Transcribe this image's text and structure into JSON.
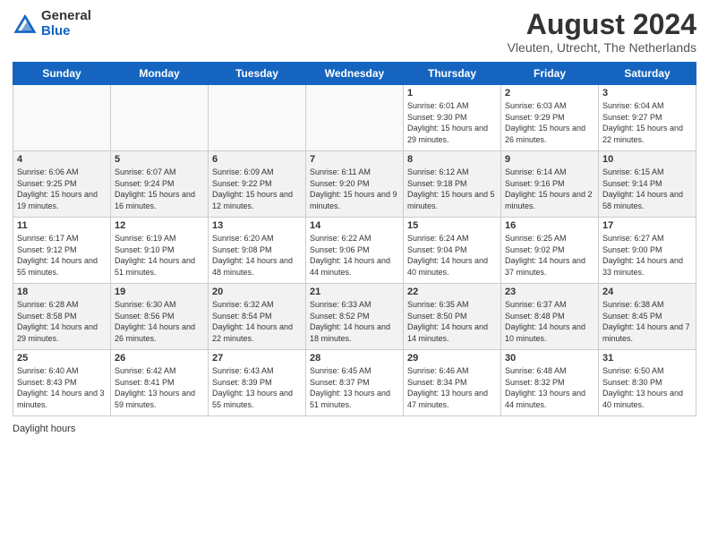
{
  "header": {
    "title": "August 2024",
    "location": "Vleuten, Utrecht, The Netherlands",
    "logo_general": "General",
    "logo_blue": "Blue"
  },
  "days_of_week": [
    "Sunday",
    "Monday",
    "Tuesday",
    "Wednesday",
    "Thursday",
    "Friday",
    "Saturday"
  ],
  "weeks": [
    [
      {
        "day": "",
        "info": ""
      },
      {
        "day": "",
        "info": ""
      },
      {
        "day": "",
        "info": ""
      },
      {
        "day": "",
        "info": ""
      },
      {
        "day": "1",
        "info": "Sunrise: 6:01 AM\nSunset: 9:30 PM\nDaylight: 15 hours and 29 minutes."
      },
      {
        "day": "2",
        "info": "Sunrise: 6:03 AM\nSunset: 9:29 PM\nDaylight: 15 hours and 26 minutes."
      },
      {
        "day": "3",
        "info": "Sunrise: 6:04 AM\nSunset: 9:27 PM\nDaylight: 15 hours and 22 minutes."
      }
    ],
    [
      {
        "day": "4",
        "info": "Sunrise: 6:06 AM\nSunset: 9:25 PM\nDaylight: 15 hours and 19 minutes."
      },
      {
        "day": "5",
        "info": "Sunrise: 6:07 AM\nSunset: 9:24 PM\nDaylight: 15 hours and 16 minutes."
      },
      {
        "day": "6",
        "info": "Sunrise: 6:09 AM\nSunset: 9:22 PM\nDaylight: 15 hours and 12 minutes."
      },
      {
        "day": "7",
        "info": "Sunrise: 6:11 AM\nSunset: 9:20 PM\nDaylight: 15 hours and 9 minutes."
      },
      {
        "day": "8",
        "info": "Sunrise: 6:12 AM\nSunset: 9:18 PM\nDaylight: 15 hours and 5 minutes."
      },
      {
        "day": "9",
        "info": "Sunrise: 6:14 AM\nSunset: 9:16 PM\nDaylight: 15 hours and 2 minutes."
      },
      {
        "day": "10",
        "info": "Sunrise: 6:15 AM\nSunset: 9:14 PM\nDaylight: 14 hours and 58 minutes."
      }
    ],
    [
      {
        "day": "11",
        "info": "Sunrise: 6:17 AM\nSunset: 9:12 PM\nDaylight: 14 hours and 55 minutes."
      },
      {
        "day": "12",
        "info": "Sunrise: 6:19 AM\nSunset: 9:10 PM\nDaylight: 14 hours and 51 minutes."
      },
      {
        "day": "13",
        "info": "Sunrise: 6:20 AM\nSunset: 9:08 PM\nDaylight: 14 hours and 48 minutes."
      },
      {
        "day": "14",
        "info": "Sunrise: 6:22 AM\nSunset: 9:06 PM\nDaylight: 14 hours and 44 minutes."
      },
      {
        "day": "15",
        "info": "Sunrise: 6:24 AM\nSunset: 9:04 PM\nDaylight: 14 hours and 40 minutes."
      },
      {
        "day": "16",
        "info": "Sunrise: 6:25 AM\nSunset: 9:02 PM\nDaylight: 14 hours and 37 minutes."
      },
      {
        "day": "17",
        "info": "Sunrise: 6:27 AM\nSunset: 9:00 PM\nDaylight: 14 hours and 33 minutes."
      }
    ],
    [
      {
        "day": "18",
        "info": "Sunrise: 6:28 AM\nSunset: 8:58 PM\nDaylight: 14 hours and 29 minutes."
      },
      {
        "day": "19",
        "info": "Sunrise: 6:30 AM\nSunset: 8:56 PM\nDaylight: 14 hours and 26 minutes."
      },
      {
        "day": "20",
        "info": "Sunrise: 6:32 AM\nSunset: 8:54 PM\nDaylight: 14 hours and 22 minutes."
      },
      {
        "day": "21",
        "info": "Sunrise: 6:33 AM\nSunset: 8:52 PM\nDaylight: 14 hours and 18 minutes."
      },
      {
        "day": "22",
        "info": "Sunrise: 6:35 AM\nSunset: 8:50 PM\nDaylight: 14 hours and 14 minutes."
      },
      {
        "day": "23",
        "info": "Sunrise: 6:37 AM\nSunset: 8:48 PM\nDaylight: 14 hours and 10 minutes."
      },
      {
        "day": "24",
        "info": "Sunrise: 6:38 AM\nSunset: 8:45 PM\nDaylight: 14 hours and 7 minutes."
      }
    ],
    [
      {
        "day": "25",
        "info": "Sunrise: 6:40 AM\nSunset: 8:43 PM\nDaylight: 14 hours and 3 minutes."
      },
      {
        "day": "26",
        "info": "Sunrise: 6:42 AM\nSunset: 8:41 PM\nDaylight: 13 hours and 59 minutes."
      },
      {
        "day": "27",
        "info": "Sunrise: 6:43 AM\nSunset: 8:39 PM\nDaylight: 13 hours and 55 minutes."
      },
      {
        "day": "28",
        "info": "Sunrise: 6:45 AM\nSunset: 8:37 PM\nDaylight: 13 hours and 51 minutes."
      },
      {
        "day": "29",
        "info": "Sunrise: 6:46 AM\nSunset: 8:34 PM\nDaylight: 13 hours and 47 minutes."
      },
      {
        "day": "30",
        "info": "Sunrise: 6:48 AM\nSunset: 8:32 PM\nDaylight: 13 hours and 44 minutes."
      },
      {
        "day": "31",
        "info": "Sunrise: 6:50 AM\nSunset: 8:30 PM\nDaylight: 13 hours and 40 minutes."
      }
    ]
  ],
  "footer": {
    "text": "Daylight hours"
  }
}
